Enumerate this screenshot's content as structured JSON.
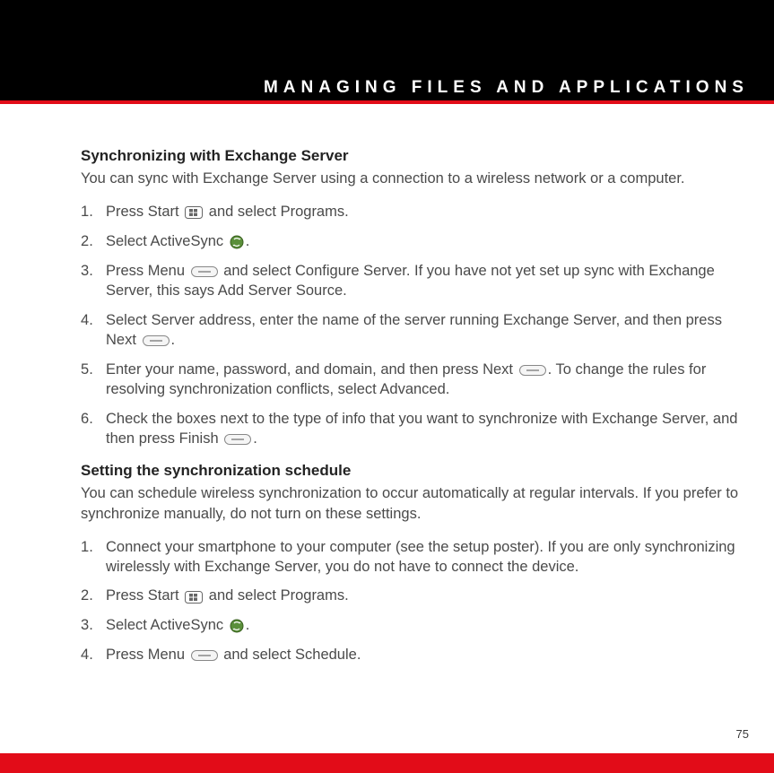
{
  "header": {
    "title": "MANAGING FILES AND APPLICATIONS"
  },
  "section1": {
    "heading": "Synchronizing with Exchange Server",
    "intro": "You can sync with Exchange Server using a connection to a wireless network or a computer.",
    "steps": {
      "s1a": "Press Start ",
      "s1b": " and select Programs.",
      "s2a": "Select ActiveSync ",
      "s2b": ".",
      "s3a": "Press Menu ",
      "s3b": " and select Configure Server. If you have not yet set up sync with Exchange Server, this says Add Server Source.",
      "s4a": "Select Server address, enter the name of the server running Exchange Server, and then press Next ",
      "s4b": ".",
      "s5a": "Enter your name, password, and domain, and then press Next ",
      "s5b": ". To change the rules for resolving synchronization conflicts, select Advanced.",
      "s6a": "Check the boxes next to the type of info that you want to synchronize with Exchange Server, and then press Finish ",
      "s6b": "."
    }
  },
  "section2": {
    "heading": "Setting the synchronization schedule",
    "intro": "You can schedule wireless synchronization to occur automatically at regular intervals. If you prefer to synchronize manually, do not turn on these settings.",
    "steps": {
      "s1": "Connect your smartphone to your computer (see the setup poster). If you are only synchronizing wirelessly with Exchange Server, you do not have to connect the device.",
      "s2a": "Press Start ",
      "s2b": " and select Programs.",
      "s3a": "Select ActiveSync ",
      "s3b": ".",
      "s4a": "Press Menu ",
      "s4b": " and select Schedule."
    }
  },
  "pageNumber": "75"
}
